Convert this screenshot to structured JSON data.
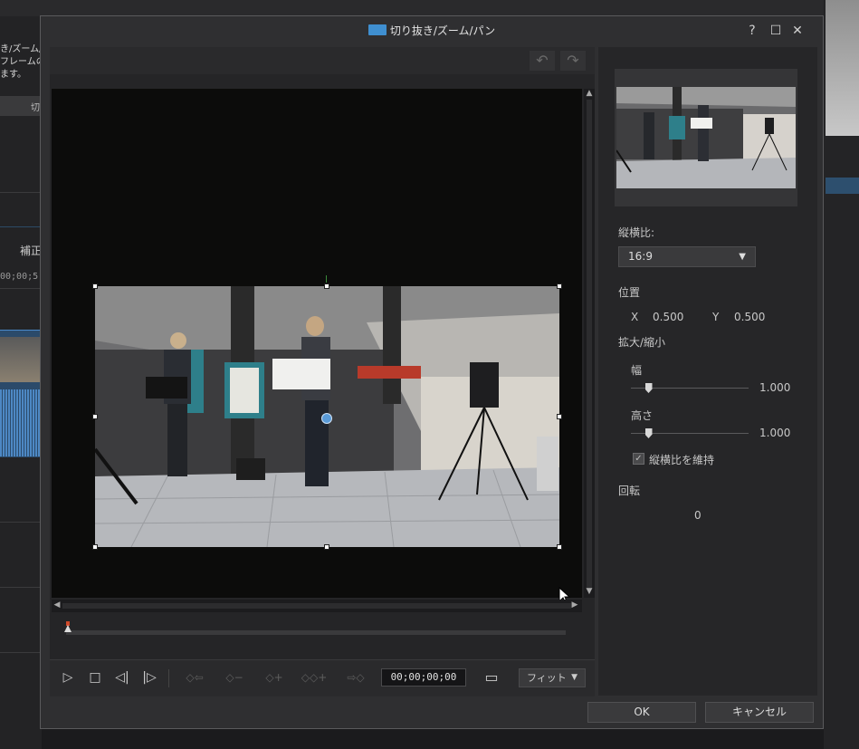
{
  "background": {
    "left_text": "き/ズーム/\nフレームの\nます。",
    "tab_label": "切",
    "section_label": "補正",
    "timecode": "00;00;5"
  },
  "dialog": {
    "title": "切り抜き/ズーム/パン",
    "help_label": "?",
    "maximize_label": "☐",
    "close_label": "✕"
  },
  "toolbar": {
    "undo_icon": "↶",
    "redo_icon": "↷"
  },
  "scroll": {
    "up": "▲",
    "down": "▼",
    "left": "◀",
    "right": "▶"
  },
  "controls": {
    "play": "▷",
    "stop": "□",
    "prev_frame": "◁|",
    "next_frame": "|▷",
    "prev_keyframe": "◇⇦",
    "remove_keyframe": "◇−",
    "add_keyframe": "◇+",
    "duplicate_keyframe": "◇◇+",
    "next_keyframe": "⇨◇",
    "timecode": "00;00;00;00",
    "safe_zone_icon": "▭",
    "fit_label": "フィット",
    "fit_arrow": "▼"
  },
  "properties": {
    "aspect_label": "縦横比:",
    "aspect_value": "16:9",
    "aspect_arrow": "▼",
    "position_label": "位置",
    "x_label": "X",
    "x_value": "0.500",
    "y_label": "Y",
    "y_value": "0.500",
    "scale_label": "拡大/縮小",
    "width_label": "幅",
    "width_value": "1.000",
    "width_fraction": 0.15,
    "height_label": "高さ",
    "height_value": "1.000",
    "height_fraction": 0.15,
    "keep_ratio_label": "縦横比を維持",
    "keep_ratio_checked": true,
    "rotation_label": "回転",
    "rotation_value": "0"
  },
  "buttons": {
    "ok": "OK",
    "cancel": "キャンセル"
  },
  "colors": {
    "accent": "#3f8fd0",
    "playhead": "#d04a2a"
  }
}
